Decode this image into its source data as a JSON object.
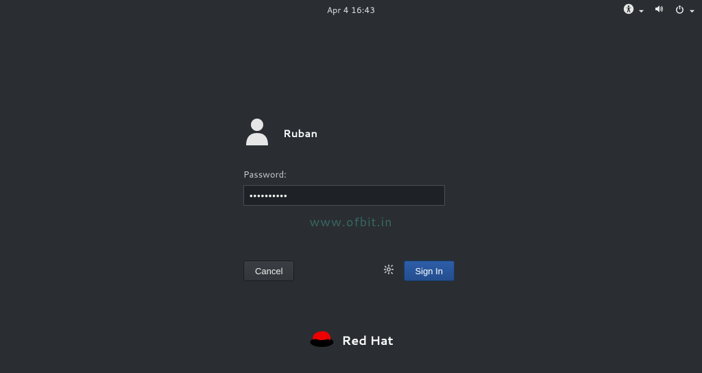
{
  "topbar": {
    "datetime": "Apr 4  16:43"
  },
  "login": {
    "username": "Ruban",
    "password_label": "Password:",
    "password_value": "••••••••••",
    "cancel_label": "Cancel",
    "signin_label": "Sign In"
  },
  "watermark": "www.ofbit.in",
  "brand": {
    "name": "Red Hat"
  },
  "colors": {
    "background": "#2a2e33",
    "primary": "#2d5ea8",
    "redhat": "#e00"
  }
}
